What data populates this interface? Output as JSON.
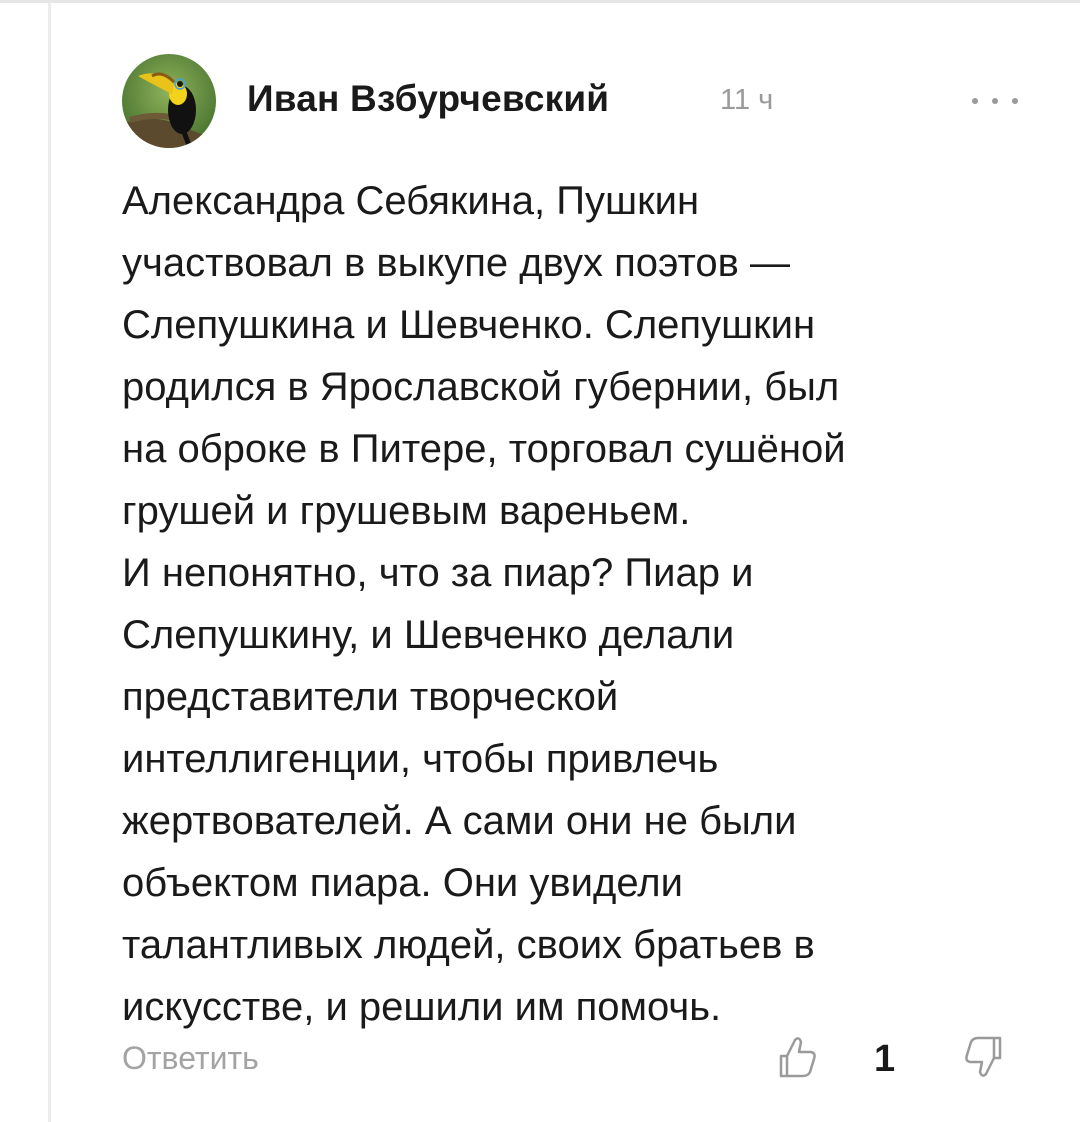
{
  "comment": {
    "author": "Иван Взбурчевский",
    "time": "11 ч",
    "avatar_icon": "toucan-avatar",
    "more_icon": "more-dots-icon",
    "body_lines": [
      "Александра Себякина, Пушкин",
      "участвовал в выкупе двух поэтов —",
      "Слепушкина и Шевченко. Слепушкин",
      "родился в Ярославской губернии, был",
      "на оброке в Питере, торговал сушёной",
      "грушей и грушевым вареньем.",
      "И непонятно, что за пиар? Пиар и",
      "Слепушкину, и Шевченко делали",
      "представители творческой",
      "интеллигенции, чтобы привлечь",
      "жертвователей. А сами они не были",
      "объектом пиара. Они увидели",
      "талантливых людей, своих братьев в",
      "искусстве, и решили им помочь."
    ],
    "reply_label": "Ответить",
    "like_count": "1",
    "like_icon": "thumb-up-icon",
    "dislike_icon": "thumb-down-icon"
  },
  "colors": {
    "text": "#1a1a1a",
    "muted": "#9a9a9a",
    "background": "#ffffff"
  }
}
